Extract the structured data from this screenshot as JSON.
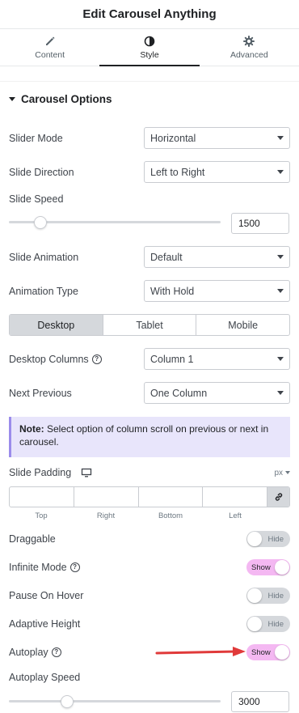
{
  "header": {
    "title": "Edit Carousel Anything"
  },
  "tabs": [
    {
      "label": "Content",
      "icon": "pencil-icon"
    },
    {
      "label": "Style",
      "icon": "contrast-icon"
    },
    {
      "label": "Advanced",
      "icon": "gear-icon"
    }
  ],
  "active_tab": "Style",
  "section": {
    "title": "Carousel Options"
  },
  "fields": {
    "slider_mode": {
      "label": "Slider Mode",
      "value": "Horizontal"
    },
    "slide_direction": {
      "label": "Slide Direction",
      "value": "Left to Right"
    },
    "slide_speed": {
      "label": "Slide Speed",
      "value": "1500"
    },
    "slide_animation": {
      "label": "Slide Animation",
      "value": "Default"
    },
    "animation_type": {
      "label": "Animation Type",
      "value": "With Hold"
    },
    "devices": [
      "Desktop",
      "Tablet",
      "Mobile"
    ],
    "active_device": "Desktop",
    "desktop_columns": {
      "label": "Desktop Columns",
      "value": "Column 1"
    },
    "next_previous": {
      "label": "Next Previous",
      "value": "One Column"
    },
    "note": {
      "bold": "Note:",
      "text": " Select option of column scroll on previous or next in carousel."
    },
    "slide_padding": {
      "label": "Slide Padding",
      "unit": "px",
      "sides": [
        "Top",
        "Right",
        "Bottom",
        "Left"
      ]
    },
    "draggable": {
      "label": "Draggable",
      "state": "Hide"
    },
    "infinite_mode": {
      "label": "Infinite Mode",
      "state": "Show"
    },
    "pause_on_hover": {
      "label": "Pause On Hover",
      "state": "Hide"
    },
    "adaptive_height": {
      "label": "Adaptive Height",
      "state": "Hide"
    },
    "autoplay": {
      "label": "Autoplay",
      "state": "Show"
    },
    "autoplay_speed": {
      "label": "Autoplay Speed",
      "value": "3000"
    }
  },
  "colors": {
    "toggle_on": "#f4b8f2",
    "note_bg": "#e8e5fb",
    "annotation_arrow": "#e03a3a"
  }
}
